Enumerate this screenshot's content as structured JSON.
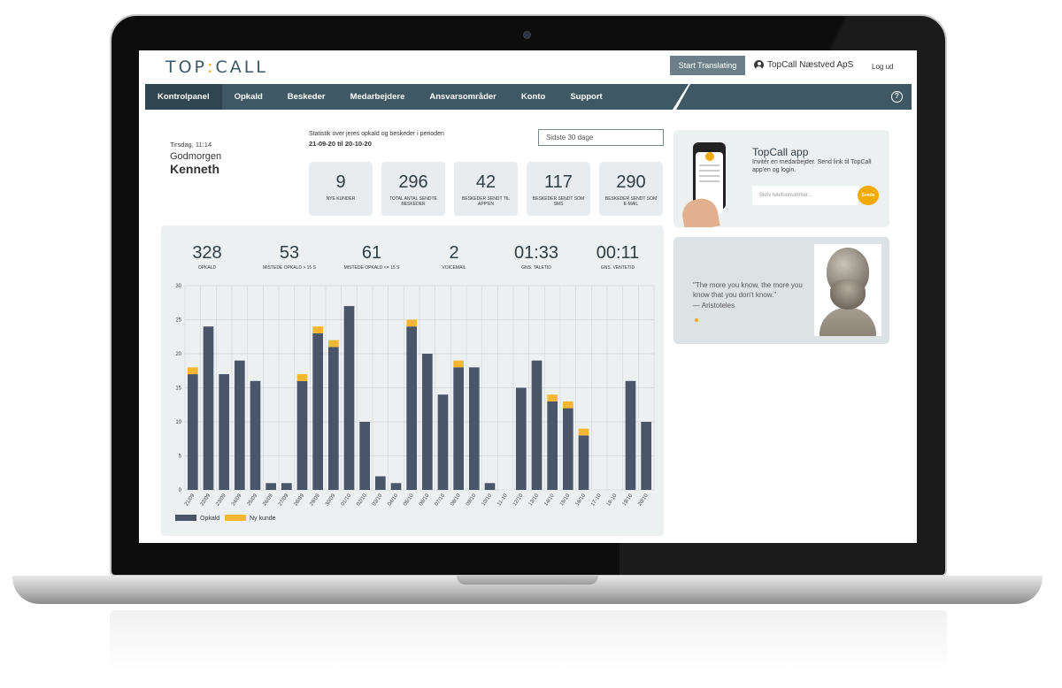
{
  "header": {
    "logo_left": "TOP",
    "logo_sep": ":",
    "logo_right": "CALL",
    "translate_label": "Start Translating",
    "company": "TopCall Næstved ApS",
    "logout": "Log ud"
  },
  "nav": {
    "items": [
      {
        "label": "Kontrolpanel",
        "active": true
      },
      {
        "label": "Opkald"
      },
      {
        "label": "Beskeder"
      },
      {
        "label": "Medarbejdere"
      },
      {
        "label": "Ansvarsområder"
      },
      {
        "label": "Konto"
      },
      {
        "label": "Support"
      }
    ],
    "help_icon": "?"
  },
  "greeting": {
    "date": "Tirsdag, 11:14",
    "hello": "Godmorgen",
    "name": "Kenneth"
  },
  "period": {
    "label": "Statistik over jeres opkald og beskeder i perioden",
    "dates": "21-09-20 til 20-10-20",
    "select": "Sidste 30 dage"
  },
  "stats": [
    {
      "value": "9",
      "label": "NYE KUNDER"
    },
    {
      "value": "296",
      "label": "TOTAL ANTAL SENDTE BESKEDER"
    },
    {
      "value": "42",
      "label": "BESKEDER SENDT TIL APP'EN"
    },
    {
      "value": "117",
      "label": "BESKEDER SENDT SOM SMS"
    },
    {
      "value": "290",
      "label": "BESKEDER SENDT SOM E-MAIL"
    }
  ],
  "kpis": [
    {
      "value": "328",
      "label": "OPKALD"
    },
    {
      "value": "53",
      "label": "MISTEDE OPKALD > 15 S"
    },
    {
      "value": "61",
      "label": "MISTEDE OPKALD <= 15 S"
    },
    {
      "value": "2",
      "label": "VOICEMAIL"
    },
    {
      "value": "01:33",
      "label": "GNS. TALETID"
    },
    {
      "value": "00:11",
      "label": "GNS. VENTETID"
    }
  ],
  "app": {
    "title": "TopCall app",
    "desc": "Invitér en medarbejder. Send link til TopCall app'en og login.",
    "placeholder": "Skriv telefonnummer...",
    "send": "Sende"
  },
  "quote": {
    "text": "\"The more you know, the more you know that you don't know.\"",
    "author": "— Aristoteles"
  },
  "colors": {
    "nav": "#3e5963",
    "bar": "#4a556a",
    "new_customer": "#f5b731",
    "accent": "#f2a900"
  },
  "chart_data": {
    "type": "bar",
    "stacked": true,
    "categories": [
      "21/09",
      "22/09",
      "23/09",
      "24/09",
      "25/09",
      "26/09",
      "27/09",
      "28/09",
      "29/09",
      "30/09",
      "01/10",
      "02/10",
      "03/10",
      "04/10",
      "05/10",
      "06/10",
      "07/10",
      "08/10",
      "09/10",
      "10/10",
      "11-10",
      "12/10",
      "13/10",
      "14/10",
      "15/10",
      "16/10",
      "17-10",
      "18-10",
      "19/10",
      "20/10"
    ],
    "series": [
      {
        "name": "Opkald",
        "values": [
          17,
          24,
          17,
          19,
          16,
          1,
          1,
          16,
          23,
          21,
          27,
          10,
          2,
          1,
          24,
          20,
          14,
          18,
          18,
          1,
          0,
          15,
          19,
          13,
          12,
          8,
          0,
          0,
          16,
          10
        ]
      },
      {
        "name": "Ny kunde",
        "values": [
          1,
          0,
          0,
          0,
          0,
          0,
          0,
          1,
          1,
          1,
          0,
          0,
          0,
          0,
          1,
          0,
          0,
          1,
          0,
          0,
          0,
          0,
          0,
          1,
          1,
          1,
          0,
          0,
          0,
          0
        ]
      }
    ],
    "yticks": [
      0,
      5,
      10,
      15,
      20,
      25,
      30
    ],
    "ylim": [
      0,
      30
    ],
    "grid": true,
    "legend_position": "bottom-left"
  }
}
